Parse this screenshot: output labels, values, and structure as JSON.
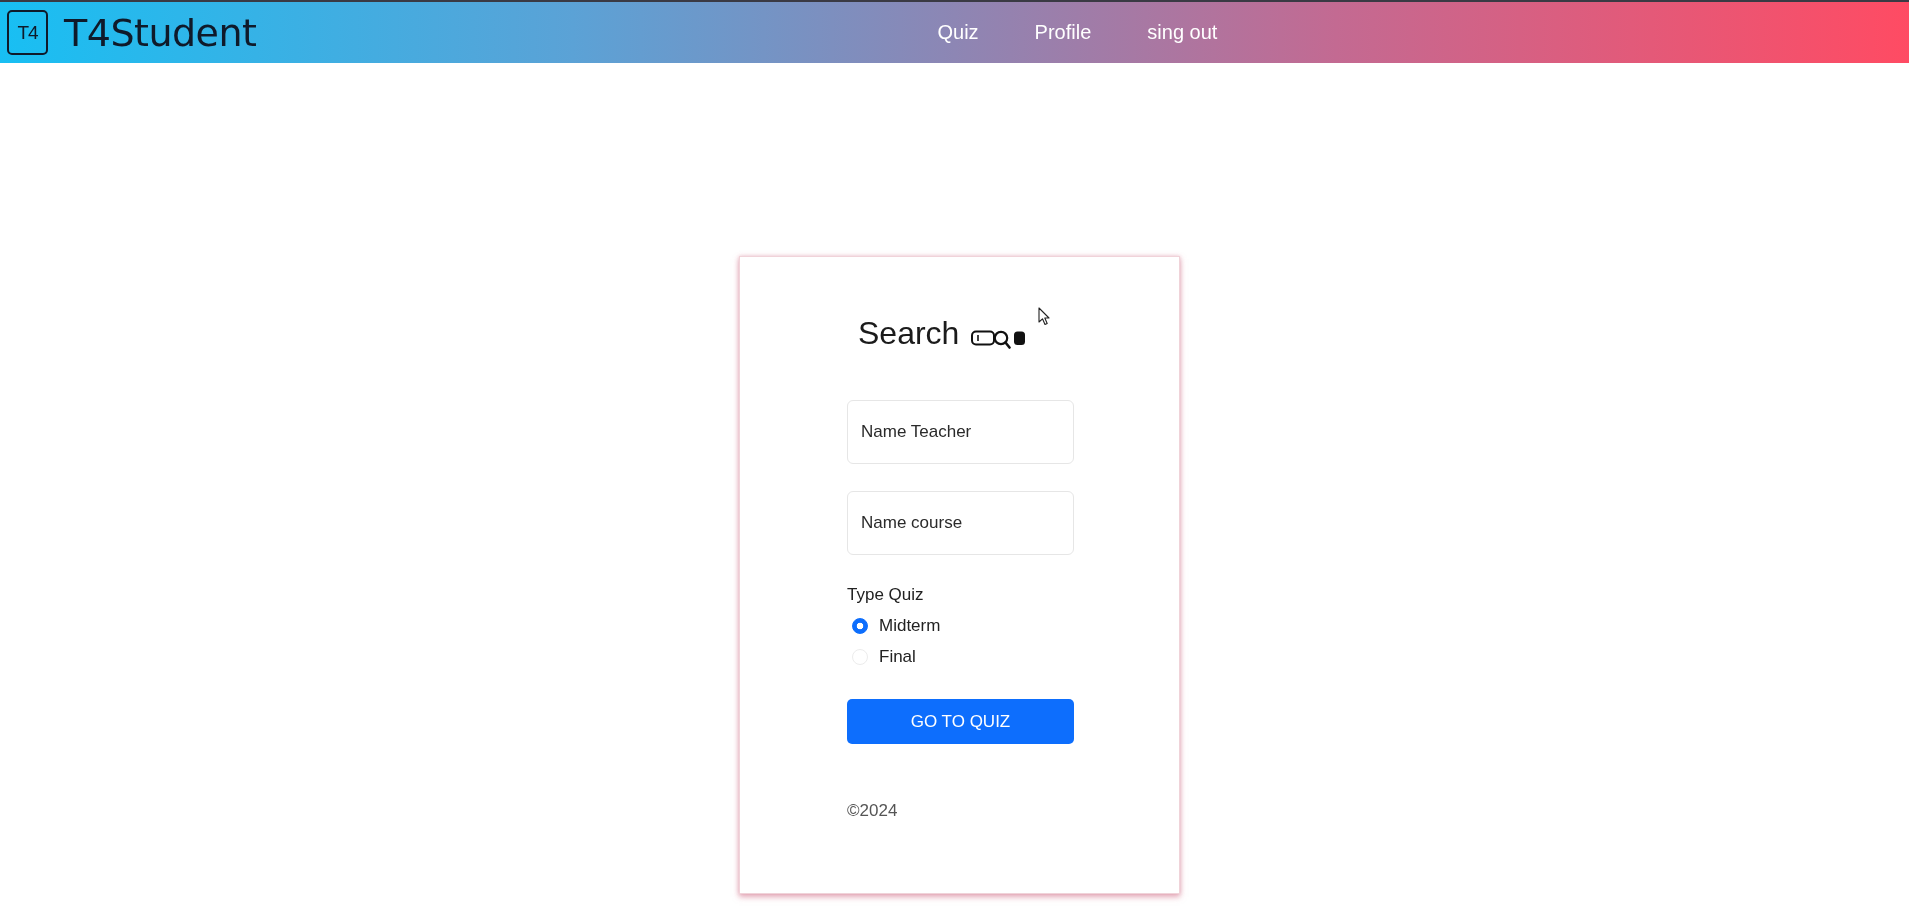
{
  "header": {
    "logo_badge": "T4",
    "brand": "T4Student",
    "nav": [
      "Quiz",
      "Profile",
      "sing out"
    ]
  },
  "search_card": {
    "title": "Search",
    "fields": [
      {
        "placeholder": "Name Teacher"
      },
      {
        "placeholder": "Name course"
      }
    ],
    "type_quiz": {
      "label": "Type Quiz",
      "options": [
        {
          "label": "Midterm",
          "selected": true
        },
        {
          "label": "Final",
          "selected": false
        }
      ]
    },
    "submit_button": "GO TO QUIZ",
    "footer": "©2024"
  }
}
